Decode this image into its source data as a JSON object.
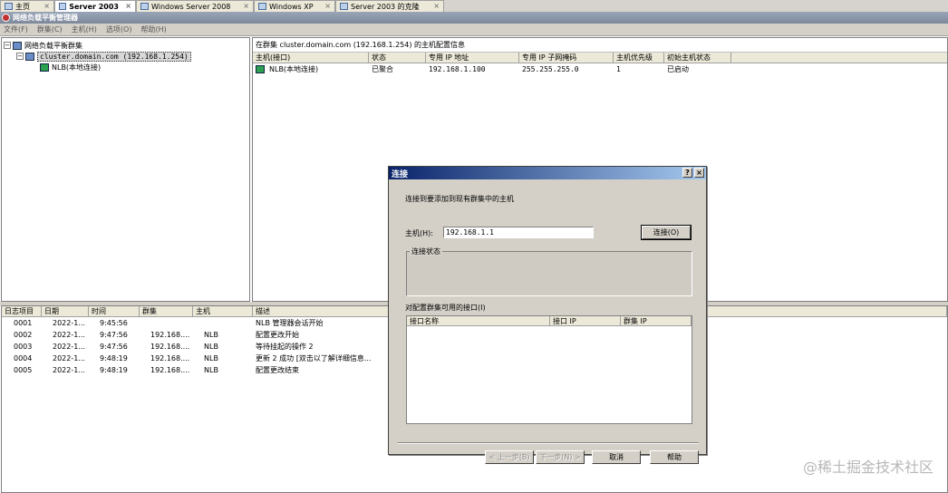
{
  "vm_tabs": [
    {
      "label": "主页",
      "active": false
    },
    {
      "label": "Server 2003",
      "active": true
    },
    {
      "label": "Windows Server 2008",
      "active": false
    },
    {
      "label": "Windows XP",
      "active": false
    },
    {
      "label": "Server 2003 的克隆",
      "active": false
    }
  ],
  "app": {
    "title": "网络负载平衡管理器"
  },
  "menu": [
    "文件(F)",
    "群集(C)",
    "主机(H)",
    "选项(O)",
    "帮助(H)"
  ],
  "tree": {
    "root": "网络负载平衡群集",
    "cluster": "cluster.domain.com (192.168.1.254)",
    "host": "NLB(本地连接)"
  },
  "right": {
    "title": "在群集 cluster.domain.com (192.168.1.254) 的主机配置信息",
    "columns": [
      "主机(接口)",
      "状态",
      "专用 IP 地址",
      "专用 IP 子网掩码",
      "主机优先级",
      "初始主机状态"
    ],
    "rows": [
      [
        "NLB(本地连接)",
        "已聚合",
        "192.168.1.100",
        "255.255.255.0",
        "1",
        "已启动"
      ]
    ]
  },
  "log": {
    "columns": [
      "日志项目",
      "日期",
      "时间",
      "群集",
      "主机",
      "描述"
    ],
    "rows": [
      [
        "0001",
        "2022-1...",
        "9:45:56",
        "",
        "",
        "NLB 管理器会话开始"
      ],
      [
        "0002",
        "2022-1...",
        "9:47:56",
        "192.168....",
        "NLB",
        "配置更改开始"
      ],
      [
        "0003",
        "2022-1...",
        "9:47:56",
        "192.168....",
        "NLB",
        "等待挂起的操作 2"
      ],
      [
        "0004",
        "2022-1...",
        "9:48:19",
        "192.168....",
        "NLB",
        "更新 2 成功 [双击以了解详细信息..."
      ],
      [
        "0005",
        "2022-1...",
        "9:48:19",
        "192.168....",
        "NLB",
        "配置更改结束"
      ]
    ]
  },
  "dialog": {
    "title": "连接",
    "help_btn": "?",
    "close_btn": "×",
    "instruction": "连接到要添加到现有群集中的主机",
    "host_label": "主机(H):",
    "host_value": "192.168.1.1",
    "connect_btn": "连接(O)",
    "status_legend": "连接状态",
    "interfaces_label": "对配置群集可用的接口(I)",
    "iface_columns": [
      "接口名称",
      "接口 IP",
      "群集 IP"
    ],
    "back_btn": "< 上一步(B)",
    "next_btn": "下一步(N) >",
    "cancel_btn": "取消",
    "help_btn_label": "帮助"
  },
  "watermark": "@稀土掘金技术社区"
}
